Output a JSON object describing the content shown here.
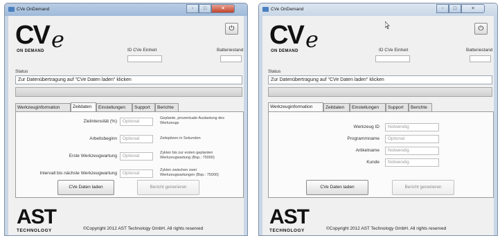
{
  "left": {
    "title": "CVe OnDemand",
    "logo": {
      "main": "CV",
      "e": "e",
      "sub": "ON DEMAND"
    },
    "power_icon": "power-icon",
    "unit_id_label": "ID CVe Einheit",
    "battery_label": "Batteriestand",
    "status_label": "Status",
    "status_value": "Zur Datenübertragung auf \"CVe Daten laden\" klicken",
    "tabs": [
      "Werkzeuginformation",
      "Zeitdaten",
      "Einstellungen",
      "Support",
      "Berichte"
    ],
    "active_tab": 1,
    "rows": [
      {
        "label": "Zielintensität (%)",
        "value": "Optional",
        "desc": "Geplante, prozentuale Auslastung des Werkzeugs"
      },
      {
        "label": "Arbeitsbeginn",
        "value": "Optional",
        "desc": "Zeitspitzen in Sekunden"
      },
      {
        "label": "Erste Werkzeugwartung",
        "value": "Optional",
        "desc": "Zyklen bis zur ersten geplanten Werkzeugwartung (Bsp.: 75000)"
      },
      {
        "label": "Intervall bis nächste Werkzeugwartung",
        "value": "Optional",
        "desc": "Zyklen zwischen zwei Werkzeugwartungen (Bsp.: 75000)"
      }
    ],
    "btn_load": "CVe Daten laden",
    "btn_report": "Bericht generieren",
    "ast": "AST",
    "technology": "TECHNOLOGY",
    "copyright": "©Copyright 2012 AST Technology GmbH. All rights reserved"
  },
  "right": {
    "title": "CVe OnDemand",
    "logo": {
      "main": "CV",
      "e": "e",
      "sub": "ON DEMAND"
    },
    "power_icon": "power-icon",
    "unit_id_label": "ID CVe Einheit",
    "battery_label": "Batteriestand",
    "status_label": "Status",
    "status_value": "Zur Datenübertragung auf \"CVe Daten laden\" klicken",
    "tabs": [
      "Werkzeuginformation",
      "Zeitdaten",
      "Einstellungen",
      "Support",
      "Berichte"
    ],
    "active_tab": 0,
    "rows": [
      {
        "label": "Werkzeug ID",
        "value": "Notwendig"
      },
      {
        "label": "Programmname",
        "value": "Optional"
      },
      {
        "label": "Artikelname",
        "value": "Notwendig"
      },
      {
        "label": "Kunde",
        "value": "Notwendig"
      }
    ],
    "btn_load": "CVe Daten laden",
    "btn_report": "Bericht generieren",
    "ast": "AST",
    "technology": "TECHNOLOGY",
    "copyright": "©Copyright 2012 AST Technology GmbH. All rights reserved"
  },
  "window_controls": {
    "min": "-",
    "max": "□",
    "close": "×"
  }
}
